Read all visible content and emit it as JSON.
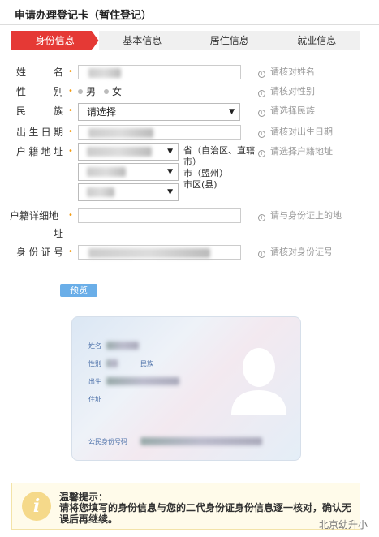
{
  "header": {
    "title": "申请办理登记卡（暂住登记）"
  },
  "tabs": [
    {
      "label": "身份信息",
      "active": true
    },
    {
      "label": "基本信息",
      "active": false
    },
    {
      "label": "居住信息",
      "active": false
    },
    {
      "label": "就业信息",
      "active": false
    }
  ],
  "form": {
    "name": {
      "label": "姓　名",
      "hint": "请核对姓名"
    },
    "gender": {
      "label": "性　别",
      "options": [
        "男",
        "女"
      ],
      "hint": "请核对性别"
    },
    "ethnicity": {
      "label": "民　族",
      "value": "请选择",
      "hint": "请选择民族"
    },
    "birthdate": {
      "label": "出生日期",
      "hint": "请核对出生日期"
    },
    "hukou": {
      "label": "户籍地址",
      "suffix1": "省（自治区、直辖市）",
      "suffix2": "市（盟州）",
      "suffix3": "市区(县)",
      "hint": "请选择户籍地址"
    },
    "hukou_detail": {
      "label_line1": "户籍详细地",
      "label_line2": "址",
      "hint": "请与身份证上的地"
    },
    "id_number": {
      "label": "身份证号",
      "hint": "请核对身份证号"
    }
  },
  "preview_button": "预览",
  "card": {
    "name_label": "姓名",
    "gender_label": "性别",
    "ethnicity_label": "民族",
    "birth_label": "出生",
    "address_label": "住址",
    "id_label": "公民身份号码"
  },
  "notice": {
    "title": "温馨提示：",
    "text": "请将您填写的身份信息与您的二代身份证身份信息逐一核对，确认无误后再继续。",
    "icon": "i"
  },
  "watermark": "北京幼升小"
}
